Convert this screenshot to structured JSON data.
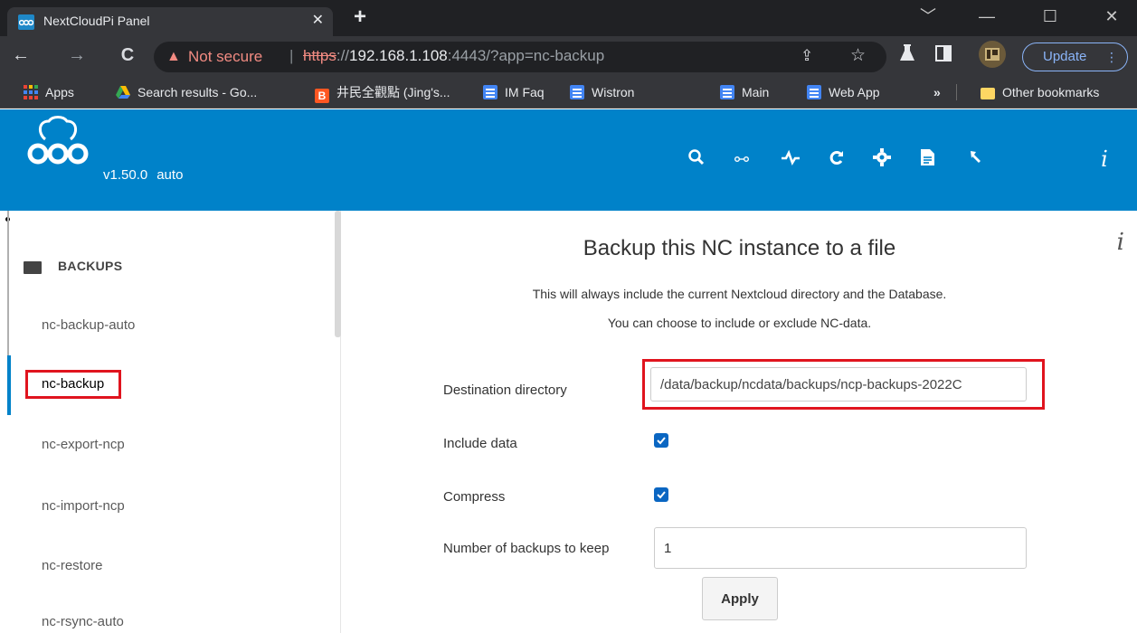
{
  "browser": {
    "tab": {
      "title": "NextCloudPi Panel",
      "close_glyph": "✕"
    },
    "new_tab_glyph": "+",
    "window_controls": {
      "dropdown": "﹀",
      "minimize": "—",
      "maximize": "☐",
      "close": "✕"
    },
    "nav": {
      "back": "←",
      "forward": "→",
      "reload": "C"
    },
    "address": {
      "security_label": "Not secure",
      "separator": "|",
      "url_scheme": "https",
      "url_sep": "://",
      "url_host": "192.168.1.108",
      "url_rest": ":4443/?app=nc-backup"
    },
    "update_label": "Update",
    "update_menu": "⋮",
    "bookmarks": [
      {
        "label": "Apps"
      },
      {
        "label": "Search results - Go..."
      },
      {
        "label": "井民全觀點 (Jing's..."
      },
      {
        "label": "IM Faq"
      },
      {
        "label": "Wistron"
      },
      {
        "label": "Main"
      },
      {
        "label": "Web App"
      },
      {
        "label": "»"
      },
      {
        "label": "Other bookmarks"
      }
    ]
  },
  "app": {
    "version": "v1.50.0",
    "mode": "auto",
    "header_icons": [
      "search-icon",
      "network-icon",
      "activity-icon",
      "update-icon",
      "settings-icon",
      "log-icon",
      "tools-icon",
      "info-icon"
    ],
    "sidebar": {
      "category": "BACKUPS",
      "items": [
        {
          "label": "nc-backup-auto"
        },
        {
          "label": "nc-backup"
        },
        {
          "label": "nc-export-ncp"
        },
        {
          "label": "nc-import-ncp"
        },
        {
          "label": "nc-restore"
        },
        {
          "label": "nc-rsync-auto"
        }
      ]
    },
    "main": {
      "info_glyph": "i",
      "title": "Backup this NC instance to a file",
      "description_line1": "This will always include the current Nextcloud directory and the Database.",
      "description_line2": "You can choose to include or exclude NC-data.",
      "fields": {
        "destination": {
          "label": "Destination directory",
          "value": "/data/backup/ncdata/backups/ncp-backups-2022C"
        },
        "include_data": {
          "label": "Include data",
          "checked": true
        },
        "compress": {
          "label": "Compress",
          "checked": true
        },
        "keep": {
          "label": "Number of backups to keep",
          "value": "1"
        }
      },
      "apply_label": "Apply"
    },
    "colors": {
      "header": "#0082c9",
      "highlight_box": "#e0141e",
      "checkbox": "#0a66c2"
    }
  }
}
